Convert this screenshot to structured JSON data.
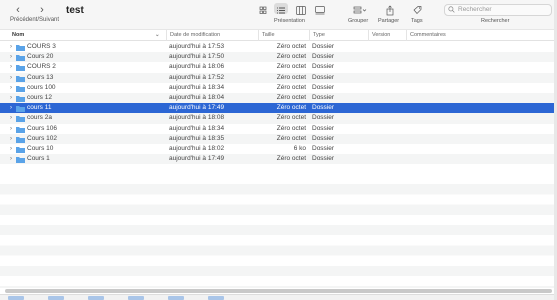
{
  "toolbar": {
    "nav_label": "Précédent/Suivant",
    "title": "test",
    "view_label": "Présentation",
    "group_label": "Grouper",
    "share_label": "Partager",
    "tags_label": "Tags",
    "search_label": "Rechercher",
    "search_placeholder": "Rechercher"
  },
  "columns": {
    "name": "Nom",
    "date": "Date de modification",
    "size": "Taille",
    "type": "Type",
    "version": "Version",
    "comments": "Commentaires"
  },
  "rows": [
    {
      "name": "COURS 3",
      "date": "aujourd'hui à 17:53",
      "size": "Zéro octet",
      "type": "Dossier"
    },
    {
      "name": "Cours 20",
      "date": "aujourd'hui à 17:50",
      "size": "Zéro octet",
      "type": "Dossier"
    },
    {
      "name": "COURS 2",
      "date": "aujourd'hui à 18:06",
      "size": "Zéro octet",
      "type": "Dossier"
    },
    {
      "name": "Cours 13",
      "date": "aujourd'hui à 17:52",
      "size": "Zéro octet",
      "type": "Dossier"
    },
    {
      "name": "cours 100",
      "date": "aujourd'hui à 18:34",
      "size": "Zéro octet",
      "type": "Dossier"
    },
    {
      "name": "cours 12",
      "date": "aujourd'hui à 18:04",
      "size": "Zéro octet",
      "type": "Dossier"
    },
    {
      "name": "cours 11",
      "date": "aujourd'hui à 17:49",
      "size": "Zéro octet",
      "type": "Dossier",
      "selected": true
    },
    {
      "name": "cours 2a",
      "date": "aujourd'hui à 18:08",
      "size": "Zéro octet",
      "type": "Dossier"
    },
    {
      "name": "Cours 106",
      "date": "aujourd'hui à 18:34",
      "size": "Zéro octet",
      "type": "Dossier"
    },
    {
      "name": "Cours 102",
      "date": "aujourd'hui à 18:35",
      "size": "Zéro octet",
      "type": "Dossier"
    },
    {
      "name": "Cours 10",
      "date": "aujourd'hui à 18:02",
      "size": "6 ko",
      "type": "Dossier"
    },
    {
      "name": "Cours 1",
      "date": "aujourd'hui à 17:49",
      "size": "Zéro octet",
      "type": "Dossier"
    }
  ],
  "colors": {
    "accent": "#2c66d4",
    "folder": "#5aa3e8"
  },
  "icons": {
    "back": "chevron-left-icon",
    "forward": "chevron-right-icon",
    "view_icons": "icon-view-icon",
    "view_list": "list-view-icon",
    "view_columns": "column-view-icon",
    "view_gallery": "gallery-view-icon",
    "group": "group-icon",
    "share": "share-icon",
    "tags": "tag-icon",
    "search": "search-icon",
    "folder": "folder-icon",
    "disclosure": "disclosure-triangle-icon"
  }
}
